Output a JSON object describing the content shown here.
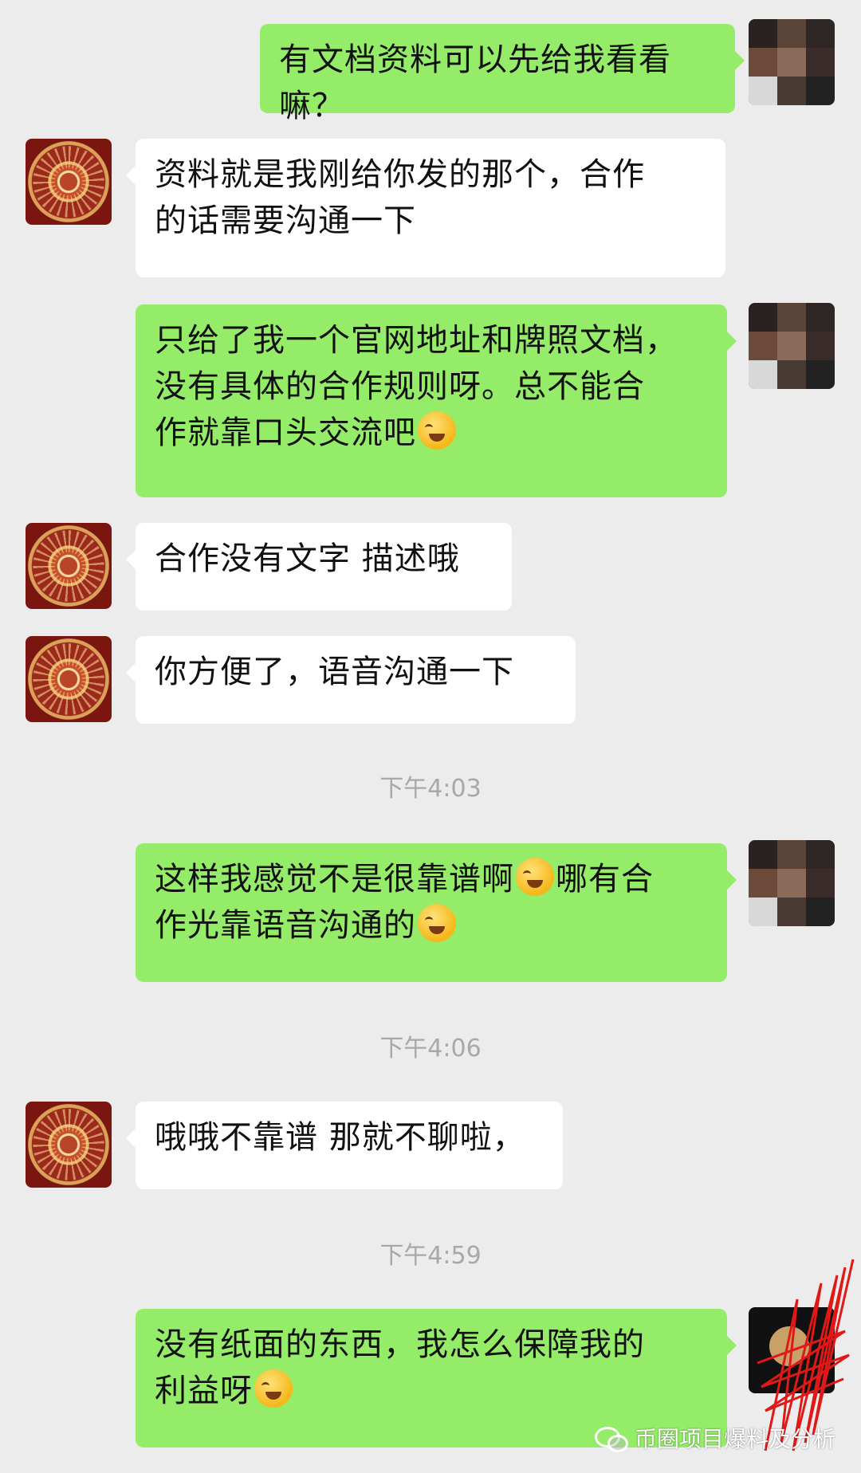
{
  "messages": [
    {
      "from": "self",
      "text": "有文档资料可以先给我看看嘛？"
    },
    {
      "from": "other",
      "line1": "资料就是我刚给你发的那个，合作",
      "line2": "的话需要沟通一下"
    },
    {
      "from": "self",
      "line1": "只给了我一个官网地址和牌照文档，",
      "line2": "没有具体的合作规则呀。总不能合",
      "line3": "作就靠口头交流吧",
      "emoji": "facepalm-emoji"
    },
    {
      "from": "other",
      "text": "合作没有文字 描述哦"
    },
    {
      "from": "other",
      "text": "你方便了，语音沟通一下"
    },
    {
      "from": "self",
      "line1a": "这样我感觉不是很靠谱啊",
      "line1b": "哪有合",
      "line2": "作光靠语音沟通的",
      "emoji": "facepalm-emoji"
    },
    {
      "from": "other",
      "text": "哦哦不靠谱 那就不聊啦，"
    },
    {
      "from": "self",
      "line1": "没有纸面的东西，我怎么保障我的",
      "line2": "利益呀",
      "emoji": "facepalm-emoji"
    }
  ],
  "timestamps": [
    "下午4:03",
    "下午4:06",
    "下午4:59"
  ],
  "watermark": "币圈项目爆料及分析",
  "colors": {
    "background": "#ececec",
    "self_bubble": "#95ec69",
    "other_bubble": "#ffffff",
    "timestamp": "#a8a8a8"
  }
}
